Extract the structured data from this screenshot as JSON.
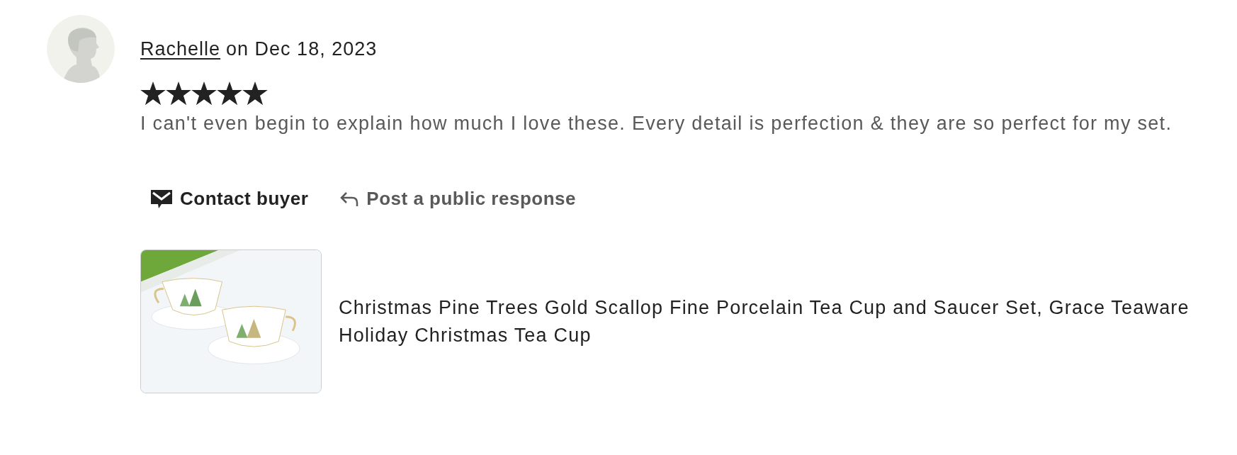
{
  "review": {
    "reviewer": "Rachelle",
    "date_text": "on Dec 18, 2023",
    "stars": 5,
    "text": "I can't even begin to explain how much I love these. Every detail is perfection & they are so perfect for my set."
  },
  "actions": [
    {
      "kind": "contact",
      "label": "Contact buyer"
    },
    {
      "kind": "reply",
      "label": "Post a public response"
    }
  ],
  "product": {
    "title": "Christmas Pine Trees Gold Scallop Fine Porcelain Tea Cup and Saucer Set, Grace Teaware Holiday Christmas Tea Cup"
  }
}
